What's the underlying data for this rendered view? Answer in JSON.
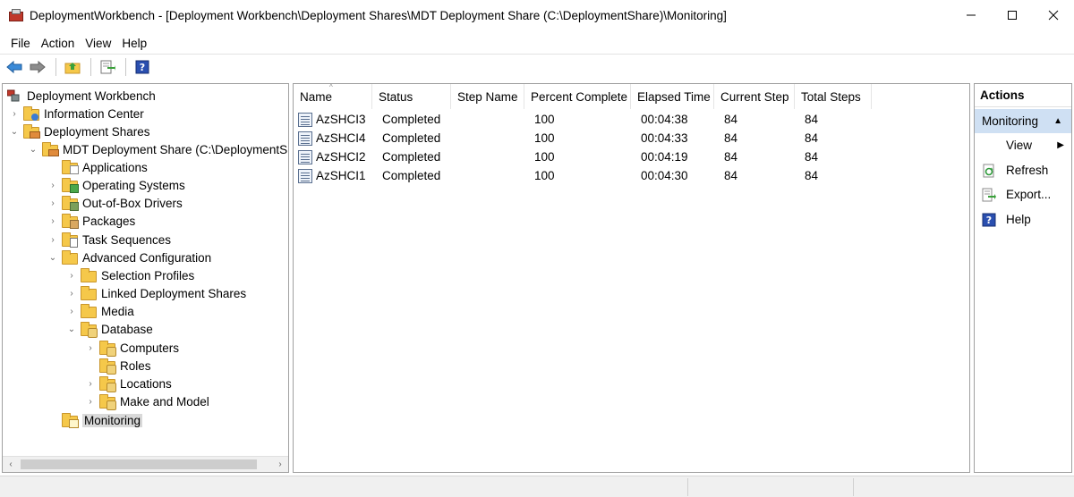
{
  "window": {
    "title": "DeploymentWorkbench - [Deployment Workbench\\Deployment Shares\\MDT Deployment Share (C:\\DeploymentShare)\\Monitoring]"
  },
  "menu": [
    "File",
    "Action",
    "View",
    "Help"
  ],
  "toolbar": {
    "icons": [
      "back-arrow-icon",
      "forward-arrow-icon",
      "up-folder-icon",
      "export-list-icon",
      "help-icon"
    ]
  },
  "tree": {
    "root": "Deployment Workbench",
    "information_center": "Information Center",
    "deployment_shares": "Deployment Shares",
    "mdt_share": "MDT Deployment Share (C:\\DeploymentShare)",
    "applications": "Applications",
    "operating_systems": "Operating Systems",
    "drivers": "Out-of-Box Drivers",
    "packages": "Packages",
    "task_sequences": "Task Sequences",
    "advanced_configuration": "Advanced Configuration",
    "selection_profiles": "Selection Profiles",
    "linked_shares": "Linked Deployment Shares",
    "media": "Media",
    "database": "Database",
    "computers": "Computers",
    "roles": "Roles",
    "locations": "Locations",
    "make_model": "Make and Model",
    "monitoring": "Monitoring"
  },
  "list": {
    "columns": [
      "Name",
      "Status",
      "Step Name",
      "Percent Complete",
      "Elapsed Time",
      "Current Step",
      "Total Steps"
    ],
    "rows": [
      {
        "name": "AzSHCI3",
        "status": "Completed",
        "step_name": "",
        "percent": "100",
        "elapsed": "00:04:38",
        "current_step": "84",
        "total_steps": "84"
      },
      {
        "name": "AzSHCI4",
        "status": "Completed",
        "step_name": "",
        "percent": "100",
        "elapsed": "00:04:33",
        "current_step": "84",
        "total_steps": "84"
      },
      {
        "name": "AzSHCI2",
        "status": "Completed",
        "step_name": "",
        "percent": "100",
        "elapsed": "00:04:19",
        "current_step": "84",
        "total_steps": "84"
      },
      {
        "name": "AzSHCI1",
        "status": "Completed",
        "step_name": "",
        "percent": "100",
        "elapsed": "00:04:30",
        "current_step": "84",
        "total_steps": "84"
      }
    ]
  },
  "actions": {
    "title": "Actions",
    "section": "Monitoring",
    "items": [
      "View",
      "Refresh",
      "Export...",
      "Help"
    ]
  },
  "colors": {
    "selection": "#cfe0f3",
    "folder": "#f5c84a",
    "tree_selected": "#d9d9d9"
  }
}
